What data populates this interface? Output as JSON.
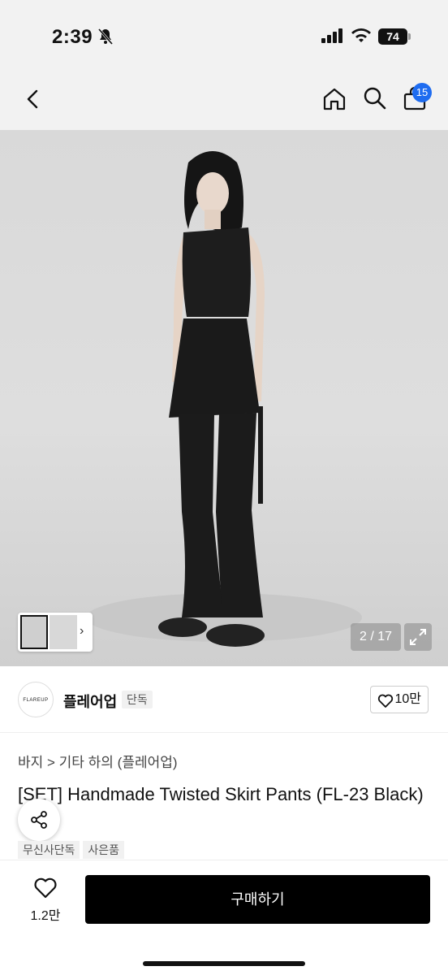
{
  "status_bar": {
    "time": "2:39",
    "battery": "74"
  },
  "navbar": {
    "cart_count": "15"
  },
  "gallery": {
    "counter": "2 / 17"
  },
  "brand": {
    "logo_text": "FLAREUP",
    "name": "플레어업",
    "tag": "단독",
    "like_count": "10만"
  },
  "breadcrumb": "바지 > 기타 하의 (플레어업)",
  "product": {
    "title": "[SET] Handmade Twisted Skirt Pants (FL-23 Black)",
    "tags": [
      "무신사단독",
      "사은품"
    ]
  },
  "bottom_bar": {
    "wish_count": "1.2만",
    "buy_label": "구매하기"
  },
  "colors": {
    "accent": "#1e6cf0",
    "buy_button": "#000000"
  }
}
